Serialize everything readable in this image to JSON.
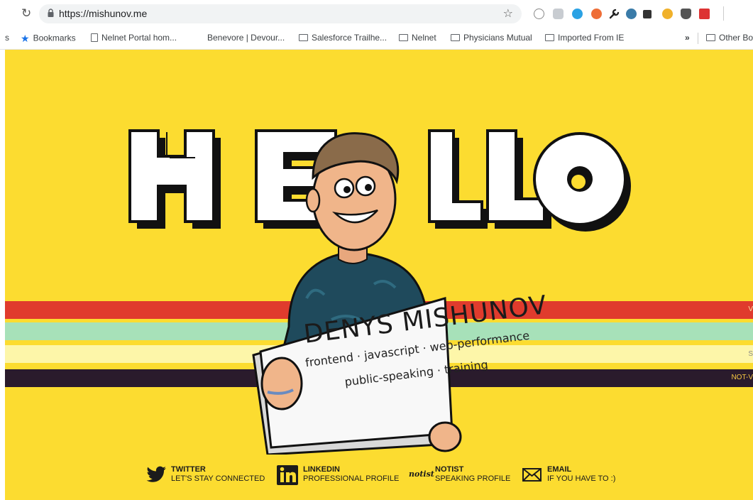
{
  "browser": {
    "url": "https://mishunov.me",
    "bookmarks": [
      {
        "label": "s",
        "icon": "none"
      },
      {
        "label": "Bookmarks",
        "icon": "star-icon"
      },
      {
        "label": "Nelnet Portal hom...",
        "icon": "page-icon"
      },
      {
        "label": "Benevore | Devour...",
        "icon": "none"
      },
      {
        "label": "Salesforce Trailhe...",
        "icon": "folder-icon"
      },
      {
        "label": "Nelnet",
        "icon": "folder-icon"
      },
      {
        "label": "Physicians Mutual",
        "icon": "folder-icon"
      },
      {
        "label": "Imported From IE",
        "icon": "folder-icon"
      },
      {
        "label": "»",
        "icon": "none"
      },
      {
        "label": "Other Bo",
        "icon": "folder-icon"
      }
    ]
  },
  "hero": {
    "sign_name": "DENYS MISHUNOV",
    "sign_line1": "frontend · javascript · web-performance",
    "sign_line2": "public-speaking · training"
  },
  "stripes": {
    "first_edge": "V",
    "third_edge": "S",
    "fourth_edge": "NOT-V"
  },
  "social": [
    {
      "title": "TWITTER",
      "sub": "LET'S STAY CONNECTED",
      "icon": "twitter-icon"
    },
    {
      "title": "LINKEDIN",
      "sub": "PROFESSIONAL PROFILE",
      "icon": "linkedin-icon"
    },
    {
      "title": "NOTIST",
      "sub": "SPEAKING PROFILE",
      "icon": "notist-icon",
      "icon_text": "notist"
    },
    {
      "title": "EMAIL",
      "sub": "IF YOU HAVE TO :)",
      "icon": "email-icon"
    }
  ],
  "colors": {
    "background": "#fcdc30",
    "stripe_red": "#e03b2d",
    "stripe_green": "#a7e1b9",
    "stripe_cream": "#fdf6a9",
    "stripe_dark": "#2a1b2c"
  }
}
